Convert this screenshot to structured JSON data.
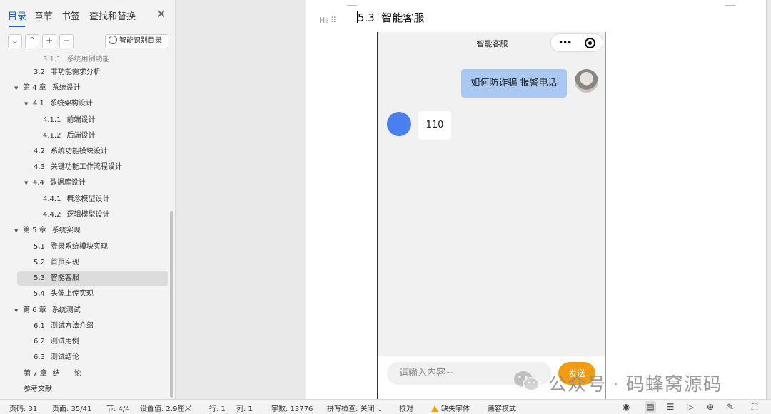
{
  "nav": {
    "tabs": [
      "目录",
      "章节",
      "书签",
      "查找和替换"
    ],
    "active_tab": "目录",
    "close_glyph": "✕",
    "toolbar": {
      "collapse_glyph": "⌄",
      "expand_glyph": "⌃",
      "add_glyph": "+",
      "remove_glyph": "−",
      "smart_label": "智能识别目录"
    },
    "toc": [
      {
        "num": "3.1.1",
        "title": "系统用例功能",
        "level": 3,
        "cut": true
      },
      {
        "num": "3.2",
        "title": "非功能需求分析",
        "level": 2
      },
      {
        "num": "第 4 章",
        "title": "系统设计",
        "level": 1,
        "expanded": true
      },
      {
        "num": "4.1",
        "title": "系统架构设计",
        "level": 2,
        "expanded": true
      },
      {
        "num": "4.1.1",
        "title": "前端设计",
        "level": 3
      },
      {
        "num": "4.1.2",
        "title": "后端设计",
        "level": 3
      },
      {
        "num": "4.2",
        "title": "系统功能模块设计",
        "level": 2
      },
      {
        "num": "4.3",
        "title": "关键功能工作流程设计",
        "level": 2
      },
      {
        "num": "4.4",
        "title": "数据库设计",
        "level": 2,
        "expanded": true
      },
      {
        "num": "4.4.1",
        "title": "概念模型设计",
        "level": 3
      },
      {
        "num": "4.4.2",
        "title": "逻辑模型设计",
        "level": 3
      },
      {
        "num": "第 5 章",
        "title": "系统实现",
        "level": 1,
        "expanded": true
      },
      {
        "num": "5.1",
        "title": "登录系统模块实现",
        "level": 2
      },
      {
        "num": "5.2",
        "title": "首页实现",
        "level": 2
      },
      {
        "num": "5.3",
        "title": "智能客服",
        "level": 2,
        "selected": true
      },
      {
        "num": "5.4",
        "title": "头像上传实现",
        "level": 2
      },
      {
        "num": "第 6 章",
        "title": "系统测试",
        "level": 1,
        "expanded": true
      },
      {
        "num": "6.1",
        "title": "测试方法介绍",
        "level": 2
      },
      {
        "num": "6.2",
        "title": "测试用例",
        "level": 2
      },
      {
        "num": "6.3",
        "title": "测试结论",
        "level": 2
      },
      {
        "num": "第 7 章",
        "title": "结　　论",
        "level": 1
      },
      {
        "num": "",
        "title": "参考文献",
        "level": 1
      }
    ]
  },
  "document": {
    "heading_marker": "H₂ ⠿",
    "heading_num": "5.3",
    "heading_text": "智能客服",
    "phone": {
      "title": "智能客服",
      "capsule_dots": "•••",
      "user_message": "如何防诈骗 报警电话",
      "bot_message": "110",
      "input_placeholder": "请输入内容~",
      "send_label": "发送"
    },
    "watermark": "公众号 · 码蜂窝源码"
  },
  "status_bar": {
    "page_code": "页码: 31",
    "page": "页面: 35/41",
    "section": "节: 4/4",
    "setting": "设置值: 2.9厘米",
    "row": "行: 1",
    "col": "列: 1",
    "word_count": "字数: 13776",
    "spell_check": "拼写检查: 关闭 ⌄",
    "proofread": "校对",
    "missing_font": "缺失字体",
    "compat_mode": "兼容模式",
    "icons": [
      "eye-icon",
      "page-view-icon",
      "outline-view-icon",
      "play-icon",
      "web-view-icon",
      "pen-icon",
      "fullscreen-icon"
    ]
  }
}
